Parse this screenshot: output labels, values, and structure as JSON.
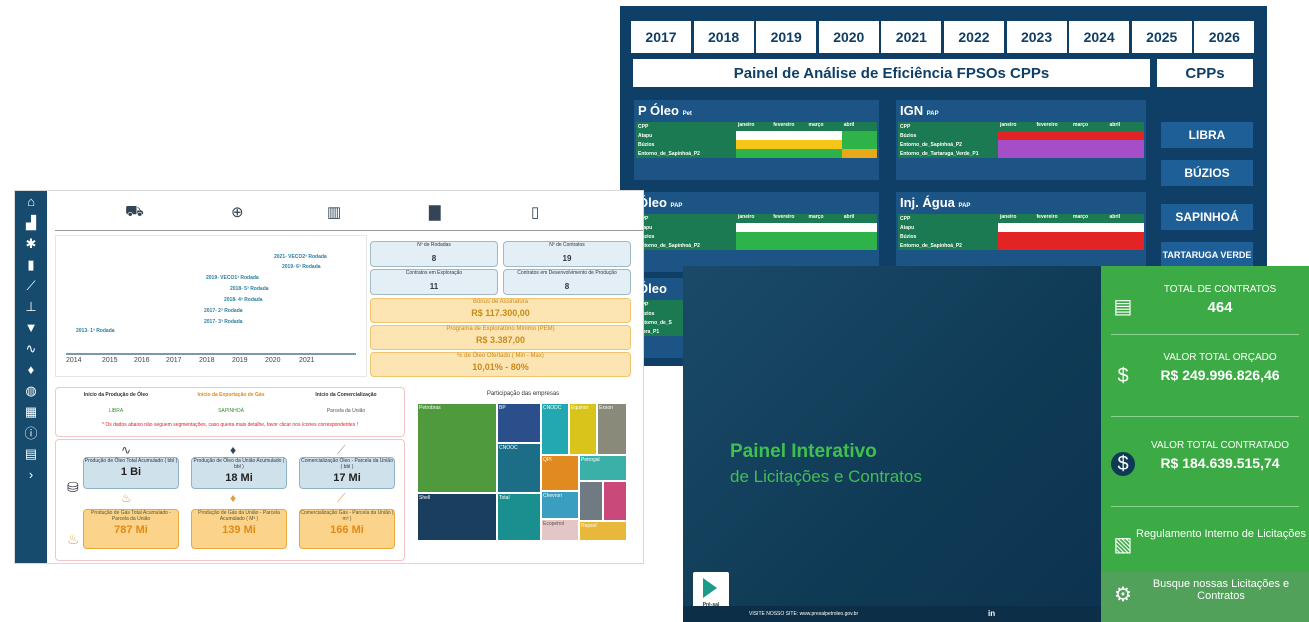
{
  "fpso": {
    "years": [
      "2017",
      "2018",
      "2019",
      "2020",
      "2021",
      "2022",
      "2023",
      "2024",
      "2025",
      "2026"
    ],
    "title": "Painel de Análise de Eficiência FPSOs CPPs",
    "cpps_label": "CPPs",
    "buttons": [
      "LIBRA",
      "BÚZIOS",
      "SAPINHOÁ",
      "TARTARUGA VERDE"
    ],
    "cards": [
      {
        "title": "P Óleo",
        "sub": "Pet",
        "rows": [
          "Atapu",
          "Búzios",
          "Entorno_de_Sapinhoá_P2"
        ]
      },
      {
        "title": "IGN",
        "sub": "PAP",
        "rows": [
          "Búzios",
          "Entorno_de_Sapinhoá_P2",
          "Entorno_de_Tartaruga_Verde_P1"
        ]
      },
      {
        "title": "Óleo",
        "sub": "PAP",
        "rows": [
          "Atapu",
          "Búzios",
          "Entorno_de_Sapinhoá_P2"
        ]
      },
      {
        "title": "Inj. Água",
        "sub": "PAP",
        "rows": [
          "Atapu",
          "Búzios",
          "Entorno_de_Sapinhoá_P2"
        ]
      },
      {
        "title": "Óleo",
        "sub": "",
        "rows": [
          "Búzios",
          "Entorno_de_S",
          "Libra_P1"
        ]
      }
    ],
    "header_cols": [
      "CPP",
      "janeiro",
      "fevereiro",
      "março",
      "abril"
    ]
  },
  "dash": {
    "timeline": {
      "years": [
        "2014",
        "2015",
        "2016",
        "2017",
        "2018",
        "2019",
        "2020",
        "2021"
      ],
      "events": [
        "2013- 1ª Rodada",
        "2017- 2ª Rodada",
        "2017- 3ª Rodada",
        "2018- 4ª Rodada",
        "2018- 5ª Rodada",
        "2019- VECO1ª Rodada",
        "2019- 6ª Rodada",
        "2021- VECO2ª Rodada"
      ]
    },
    "stats": [
      {
        "label": "Nº de Rodadas",
        "value": "8"
      },
      {
        "label": "Nº de Contratos",
        "value": "19"
      },
      {
        "label": "Contratos em Exploração",
        "value": "11"
      },
      {
        "label": "Contratos em Desenvolvimento de Produção",
        "value": "8"
      }
    ],
    "yellow": [
      {
        "label": "Bônus de Assinatura",
        "value": "R$ 117.300,00"
      },
      {
        "label": "Programa de Exploratório Mínimo (PEM)",
        "value": "R$ 3.387,00"
      },
      {
        "label": "% de Óleo Ofertado ( Min - Max)",
        "value": "10,01% - 80%"
      }
    ],
    "starts": [
      {
        "label": "Início da Produção de Óleo",
        "value": "LIBRA"
      },
      {
        "label": "Início da Exportação de Gás",
        "value": "SAPINHOÁ"
      },
      {
        "label": "Início da Comercialização",
        "value": "Parcela da União"
      }
    ],
    "warning": "* Os dados abaixo não seguem segmentações, caso queira mais detalhe, favor clicar nos ícones correspondentes !",
    "blue_cards": [
      {
        "label": "Produção de Óleo Total Acumulado ( bbl )",
        "value": "1 Bi"
      },
      {
        "label": "Produção de Óleo da União Acumulado ( bbl )",
        "value": "18 Mi"
      },
      {
        "label": "Comercialização Óleo - Parcela da União ( bbl )",
        "value": "17 Mi"
      }
    ],
    "orange_cards": [
      {
        "label": "Produção de Gás Total Acumulado - Parcela da União",
        "value": "787 Mi"
      },
      {
        "label": "Produção de Gás da União - Parcela Acumulado ( M³ )",
        "value": "139 Mi"
      },
      {
        "label": "Comercialização Gás - Parcela da União ( m³ )",
        "value": "166 Mi"
      }
    ],
    "treemap_title": "Participação das empresas",
    "treemap": [
      "Petrobras",
      "BP",
      "CNODC",
      "Equinor",
      "Exxon",
      "CNOOC",
      "QPI",
      "Petrogal",
      "Shell",
      "Total",
      "Chevron",
      "Ecopetrol",
      "Repsol"
    ]
  },
  "licit": {
    "title_line1": "Painel Interativo",
    "title_line2": "de Licitações e Contratos",
    "footer": "VISITE NOSSO SITE: www.presalpetroleo.gov.br",
    "logo_text": "Pré-sal Petróleo",
    "kpis": [
      {
        "label": "TOTAL DE CONTRATOS",
        "value": "464"
      },
      {
        "label": "VALOR TOTAL ORÇADO",
        "value": "R$ 249.996.826,46"
      },
      {
        "label": "VALOR TOTAL CONTRATADO",
        "value": "R$ 184.639.515,74"
      }
    ],
    "links": [
      "Regulamento Interno de Licitações",
      "Busque nossas Licitações e Contratos"
    ]
  }
}
